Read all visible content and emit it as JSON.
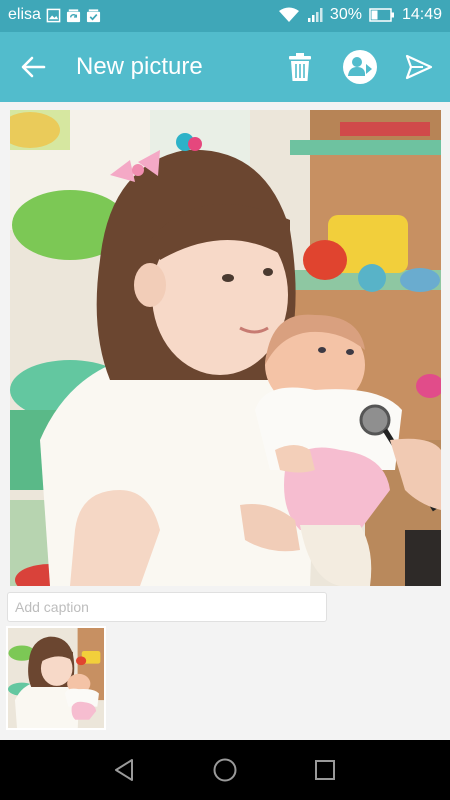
{
  "status_bar": {
    "carrier": "elisa",
    "battery": "30%",
    "time": "14:49",
    "icons": [
      "image-icon",
      "sync-icon",
      "checkbox-icon",
      "wifi-icon",
      "signal-icon",
      "battery-icon"
    ]
  },
  "app_bar": {
    "title": "New picture",
    "actions": [
      "back-arrow-icon",
      "trash-icon",
      "add-contact-icon",
      "send-icon"
    ]
  },
  "caption": {
    "placeholder": "Add caption",
    "value": ""
  },
  "nav_bar": {
    "buttons": [
      "nav-back-icon",
      "nav-home-icon",
      "nav-recent-icon"
    ]
  },
  "colors": {
    "status_bar": "#3fa7b8",
    "app_bar": "#52bccc",
    "content_bg": "#f3f3f3",
    "nav_bar": "#000000"
  }
}
